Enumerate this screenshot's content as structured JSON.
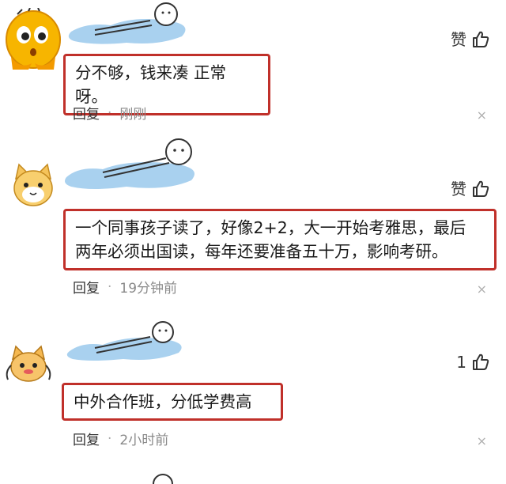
{
  "comments": [
    {
      "like_label": "赞",
      "text": "分不够，钱来凑 正常呀。",
      "reply_label": "回复",
      "time": "刚刚"
    },
    {
      "like_label": "赞",
      "text_lines": [
        "一个同事孩子读了，好像2+2，大一开始考雅思，最后",
        "两年必须出国读，每年还要准备五十万，影响考研。"
      ],
      "reply_label": "回复",
      "time": "19分钟前"
    },
    {
      "like_label": "1",
      "text": "中外合作班，分低学费高",
      "reply_label": "回复",
      "time": "2小时前"
    }
  ],
  "icons": {
    "close": "×",
    "separator": "·"
  },
  "colors": {
    "highlight_border": "#c0302a",
    "puddle": "#a9d1ef"
  }
}
